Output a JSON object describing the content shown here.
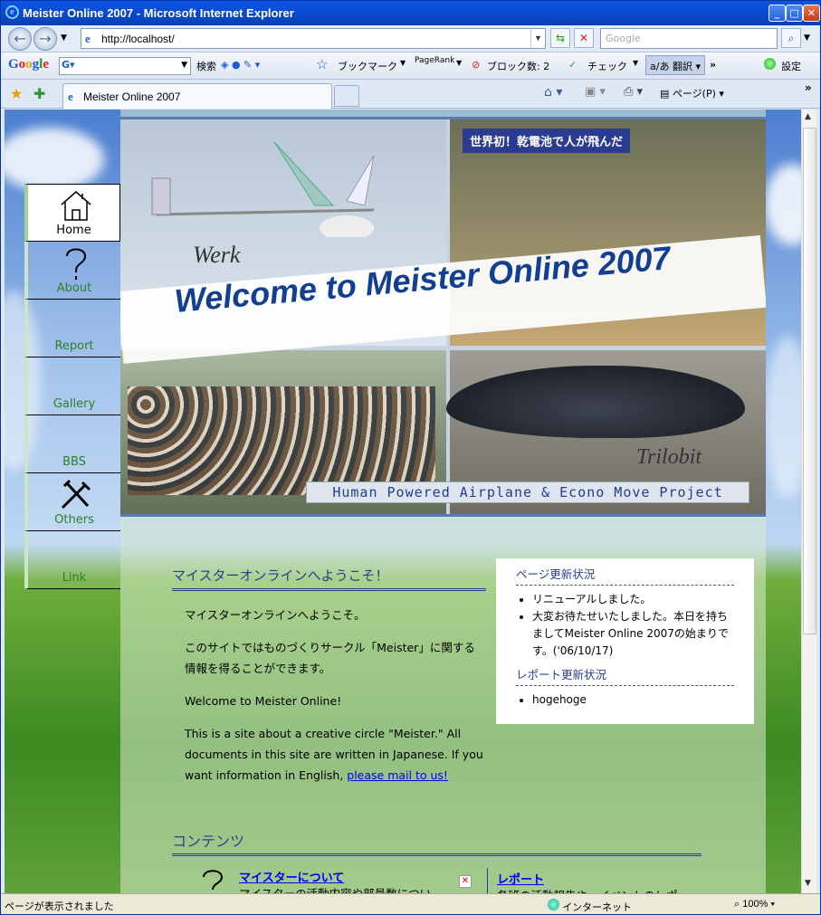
{
  "window": {
    "title": "Meister Online 2007 - Microsoft Internet Explorer"
  },
  "address": {
    "url": "http://localhost/",
    "search_placeholder": "Google"
  },
  "google_toolbar": {
    "logo": "Google",
    "search_btn": "検索",
    "pagerank": "PageRank",
    "bookmarks": "ブックマーク",
    "blocked": "ブロック数: 2",
    "check": "チェック",
    "translate": "翻訳",
    "settings": "設定"
  },
  "tabs": [
    {
      "label": "Meister Online 2007"
    }
  ],
  "command_bar": {
    "page": "ページ(P)"
  },
  "sidebar": {
    "items": [
      {
        "label": "Home",
        "icon": "house-icon",
        "active": true
      },
      {
        "label": "About",
        "icon": "question-icon"
      },
      {
        "label": "Report"
      },
      {
        "label": "Gallery"
      },
      {
        "label": "BBS"
      },
      {
        "label": "Others",
        "icon": "tools-icon"
      },
      {
        "label": "Link"
      }
    ]
  },
  "banner": {
    "welcome": "Welcome to  Meister Online 2007",
    "werk": "Werk",
    "trilobit": "Trilobit",
    "jp_sign": "世界初！乾電池で人が飛んだ",
    "project": "Human Powered Airplane & Econo Move Project"
  },
  "welcome": {
    "heading": "マイスターオンラインへようこそ！",
    "p1": "マイスターオンラインへようこそ。",
    "p2": "このサイトではものづくりサークル「Meister」に関する情報を得ることができます。",
    "p3": "Welcome to Meister Online!",
    "p4": "This is a site about a creative circle \"Meister.\" All documents in this site are written in Japanese. If you want information in English,",
    "p4_link": "please mail to us!"
  },
  "news": {
    "page_heading": "ページ更新状況",
    "page_items": [
      "リニューアルしました。",
      "大変お待たせいたしました。本日を持ちましてMeister Online 2007の始まりです。('06/10/17)"
    ],
    "report_heading": "レポート更新状況",
    "report_items": [
      "hogehoge"
    ]
  },
  "contents": {
    "heading": "コンテンツ",
    "about_link": "マイスターについて",
    "about_desc": "マイスターの活動内容や部員数につい",
    "report_link": "レポート",
    "report_desc": "各班の活動報告や、イベントのレポ"
  },
  "status": {
    "text": "ページが表示されました",
    "zone": "インターネット",
    "zoom": "100%"
  }
}
